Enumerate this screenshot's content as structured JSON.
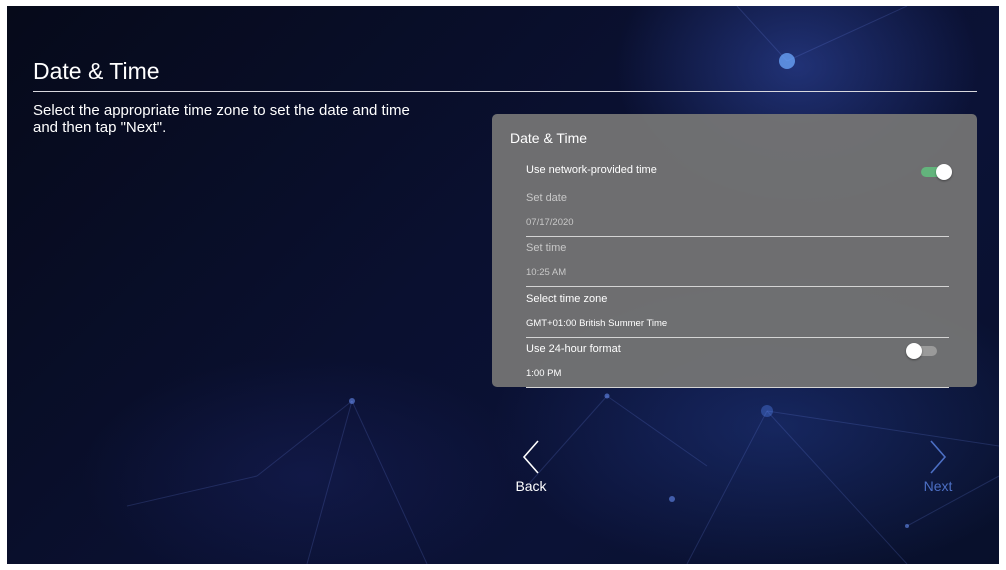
{
  "page": {
    "title": "Date & Time",
    "instruction": "Select the appropriate time zone to set the date and time and then tap \"Next\"."
  },
  "panel": {
    "title": "Date & Time",
    "network_time": {
      "label": "Use network-provided time",
      "enabled": true
    },
    "set_date": {
      "label": "Set date",
      "value": "07/17/2020"
    },
    "set_time": {
      "label": "Set time",
      "value": "10:25 AM"
    },
    "time_zone": {
      "label": "Select time zone",
      "value": "GMT+01:00 British Summer Time"
    },
    "hour_format": {
      "label": "Use 24-hour format",
      "value": "1:00 PM",
      "enabled": false
    }
  },
  "nav": {
    "back_label": "Back",
    "next_label": "Next"
  },
  "colors": {
    "toggle_on": "#63b47c",
    "toggle_off": "#9a9a9a",
    "next_accent": "#4c6fc4",
    "panel_bg": "#747474"
  },
  "icons": {
    "back": "chevron-left-icon",
    "next": "chevron-right-icon"
  }
}
